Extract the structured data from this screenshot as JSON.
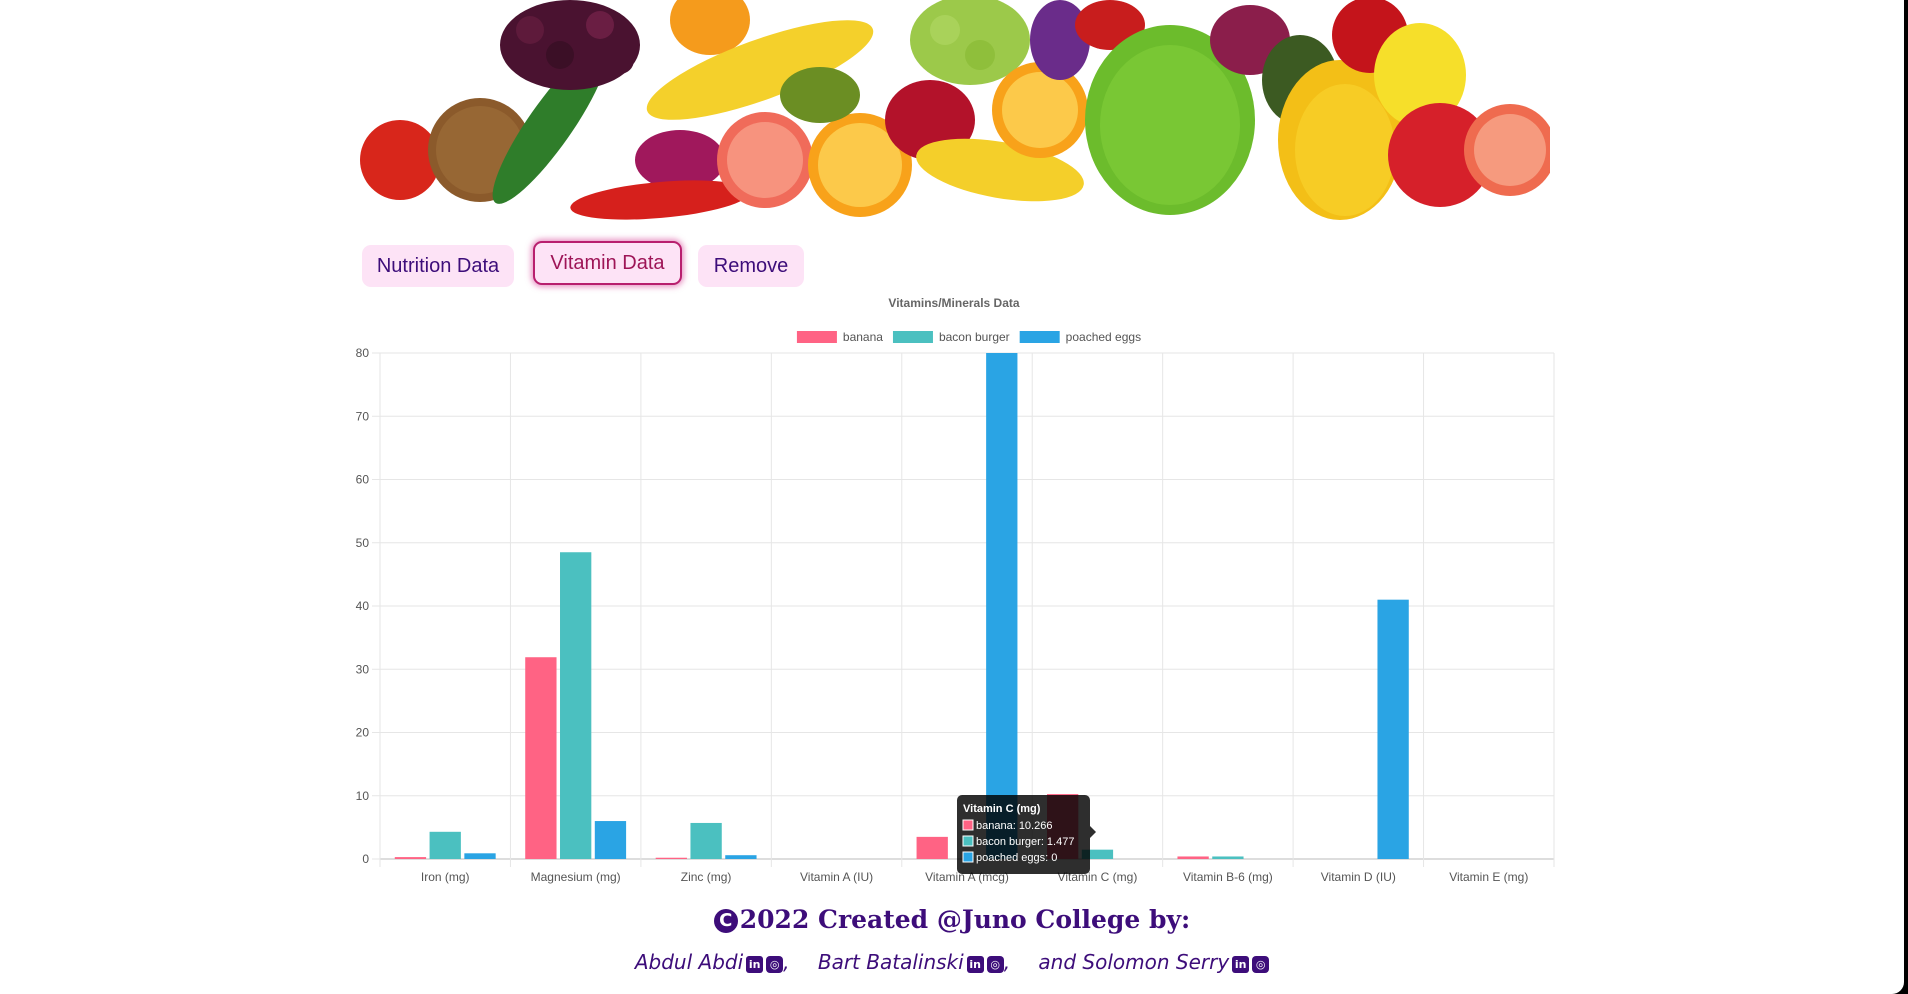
{
  "nav": {
    "nutrition_label": "Nutrition Data",
    "vitamin_label": "Vitamin Data",
    "remove_label": "Remove"
  },
  "chart_data": {
    "type": "bar",
    "title": "Vitamins/Minerals Data",
    "categories": [
      "Iron (mg)",
      "Magnesium (mg)",
      "Zinc (mg)",
      "Vitamin A (IU)",
      "Vitamin A (mcg)",
      "Vitamin C (mg)",
      "Vitamin B-6 (mg)",
      "Vitamin D (IU)",
      "Vitamin E (mg)"
    ],
    "series": [
      {
        "name": "banana",
        "color": "#ff6384",
        "values": [
          0.3,
          31.9,
          0.2,
          0,
          3.5,
          10.266,
          0.4,
          0,
          0
        ]
      },
      {
        "name": "bacon burger",
        "color": "#4bc0c0",
        "values": [
          4.3,
          48.5,
          5.7,
          0,
          0,
          1.477,
          0.4,
          0,
          0
        ]
      },
      {
        "name": "poached eggs",
        "color": "#2aa4e4",
        "values": [
          0.9,
          6,
          0.6,
          0,
          80,
          0,
          0,
          41,
          0
        ]
      }
    ],
    "ylim": [
      0,
      80
    ],
    "yticks": [
      0,
      10,
      20,
      30,
      40,
      50,
      60,
      70,
      80
    ],
    "grid": true,
    "legend": "top-center",
    "tooltip": {
      "title": "Vitamin C (mg)",
      "lines": [
        "banana: 10.266",
        "bacon burger: 1.477",
        "poached eggs: 0"
      ]
    }
  },
  "footer": {
    "copyright_symbol": "C",
    "line1": "2022 Created @Juno College by:",
    "authors": [
      {
        "name": "Abdul Abdi",
        "linkedin": "in",
        "github": "gh"
      },
      {
        "name": "Bart Batalinski",
        "linkedin": "in",
        "github": "gh"
      },
      {
        "name": "and Solomon Serry",
        "linkedin": "in",
        "github": "gh"
      }
    ],
    "separator": ","
  }
}
